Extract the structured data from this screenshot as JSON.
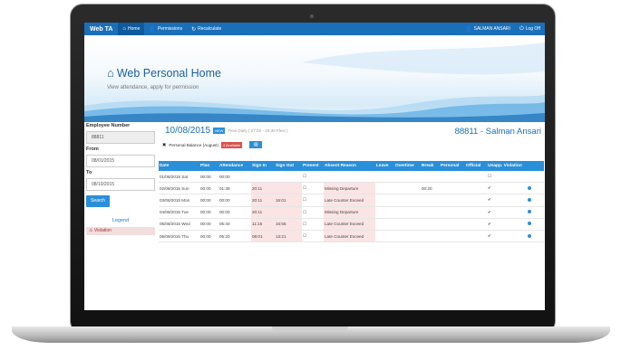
{
  "navbar": {
    "brand": "Web TA",
    "items": [
      {
        "label": "Home",
        "icon": "home-icon",
        "active": true
      },
      {
        "label": "Permissions",
        "icon": "user-icon",
        "active": false
      },
      {
        "label": "Recalculate",
        "icon": "refresh-icon",
        "active": false
      }
    ],
    "user": {
      "label": "SALMAN ANSARI",
      "icon": "user-icon"
    },
    "logoff": {
      "label": "Log Off",
      "icon": "logoff-icon"
    }
  },
  "banner": {
    "title": "Web Personal Home",
    "subtitle": "View attendance, apply for permission",
    "icon": "home-icon"
  },
  "filters": {
    "employee_number_label": "Employee Number",
    "employee_number_value": "88811",
    "from_label": "From",
    "from_value": "08/01/2015",
    "to_label": "To",
    "to_value": "08/10/2015",
    "search_label": "Search"
  },
  "legend": {
    "title": "Legend",
    "violation_label": "Violation"
  },
  "summary": {
    "date": "10/08/2015",
    "badge": "NEW",
    "schedule": "Flexi Daily ( 07:00 - 16:30 Flexi )",
    "employee": "88811 - Salman Ansari",
    "balance_label": "Personal Balance (August)",
    "balance_badge": "4 Available"
  },
  "table": {
    "headers": [
      "Date",
      "Plan",
      "Attendance",
      "Sign In",
      "Sign Out",
      "Present",
      "Absent Reason",
      "Leave",
      "Overtime",
      "Break",
      "Personal",
      "Official",
      "Unapp. Violation",
      ""
    ],
    "rows": [
      {
        "date": "01/08/2015 Sat",
        "plan": "00:00",
        "attendance": "00:00",
        "sign_in": "",
        "sign_out": "",
        "present": "☐",
        "absent_reason": "",
        "leave": "",
        "overtime": "",
        "break": "",
        "personal": "",
        "official": "",
        "violation": "☐",
        "dot": false
      },
      {
        "date": "02/08/2015 Sun",
        "plan": "00:00",
        "attendance": "01:49",
        "sign_in": "20:11",
        "sign_out": "",
        "present": "☐",
        "absent_reason": "Missing Departure",
        "leave": "",
        "overtime": "",
        "break": "00:20",
        "personal": "",
        "official": "",
        "violation": "✔",
        "dot": true
      },
      {
        "date": "03/08/2015 Mon",
        "plan": "00:00",
        "attendance": "00:00",
        "sign_in": "20:11",
        "sign_out": "16:01",
        "present": "☐",
        "absent_reason": "Late Counter Exceed",
        "leave": "",
        "overtime": "",
        "break": "",
        "personal": "",
        "official": "",
        "violation": "✔",
        "dot": true
      },
      {
        "date": "04/08/2015 Tue",
        "plan": "00:00",
        "attendance": "00:00",
        "sign_in": "20:11",
        "sign_out": "",
        "present": "☐",
        "absent_reason": "Missing Departure",
        "leave": "",
        "overtime": "",
        "break": "",
        "personal": "",
        "official": "",
        "violation": "✔",
        "dot": true
      },
      {
        "date": "05/08/2015 Wed",
        "plan": "00:00",
        "attendance": "05:40",
        "sign_in": "11:15",
        "sign_out": "16:55",
        "present": "☐",
        "absent_reason": "Late Counter Exceed",
        "leave": "",
        "overtime": "",
        "break": "",
        "personal": "",
        "official": "",
        "violation": "✔",
        "dot": true
      },
      {
        "date": "06/08/2015 Thu",
        "plan": "00:00",
        "attendance": "05:20",
        "sign_in": "08:01",
        "sign_out": "13:21",
        "present": "☐",
        "absent_reason": "Late Counter Exceed",
        "leave": "",
        "overtime": "",
        "break": "",
        "personal": "",
        "official": "",
        "violation": "✔",
        "dot": true
      }
    ]
  },
  "colors": {
    "navbar": "#1a6fb9",
    "accent": "#2a8fd9",
    "violation_bg": "#f2dede",
    "highlight_cell": "#fbe4e4"
  }
}
